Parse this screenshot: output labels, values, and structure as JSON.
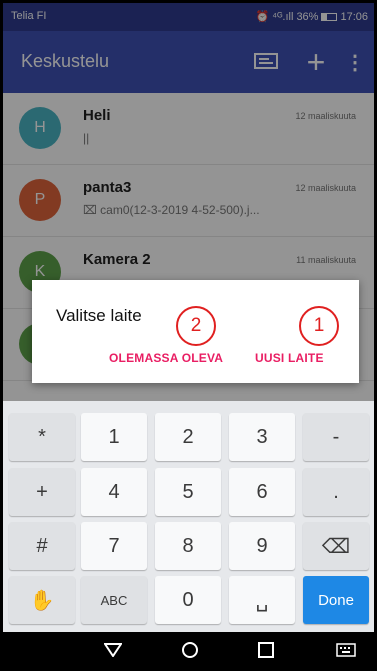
{
  "status_bar": {
    "carrier": "Telia FI",
    "indicators": "⏰ ⁴ᴳ.ıll",
    "battery": "36%",
    "time": "17:06"
  },
  "app_bar": {
    "title": "Keskustelu",
    "icons": [
      "message-icon",
      "plus-icon",
      "more-vert-icon"
    ]
  },
  "conversations": [
    {
      "initial": "H",
      "name": "Heli",
      "date": "12 maaliskuuta",
      "preview": "||",
      "color": "#4bb6c4"
    },
    {
      "initial": "P",
      "name": "panta3",
      "date": "12 maaliskuuta",
      "preview": "cam0(12-3-2019 4-52-500).j...",
      "color": "#e0643c"
    },
    {
      "initial": "K",
      "name": "Kamera 2",
      "date": "11 maaliskuuta",
      "preview": "",
      "color": "#5ea34a"
    },
    {
      "initial": "",
      "name": "",
      "date": "",
      "preview": "",
      "color": "#5ea34a"
    }
  ],
  "dialog": {
    "title": "Valitse laite",
    "existing_button": "OLEMASSA OLEVA",
    "new_button": "UUSI LAITE",
    "marker_existing": "2",
    "marker_new": "1",
    "button_color": "#e91e63"
  },
  "keyboard": {
    "row1": [
      "*",
      "1",
      "2",
      "3",
      "-"
    ],
    "row2": [
      "+",
      "4",
      "5",
      "6",
      "."
    ],
    "row3": [
      "#",
      "7",
      "8",
      "9",
      "⌫"
    ],
    "row4": [
      "✋",
      "ABC",
      "0",
      "␣",
      "Done"
    ]
  },
  "colors": {
    "primary": "#3f51b5",
    "status_bar": "#2f3c8f",
    "accent": "#e91e63",
    "done_key": "#1e88e5"
  }
}
